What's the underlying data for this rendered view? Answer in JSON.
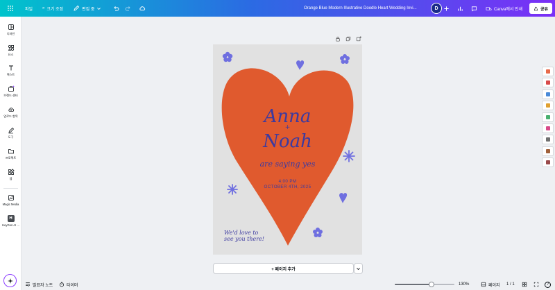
{
  "topbar": {
    "file_label": "파일",
    "resize_label": "크기 조정",
    "editing_label": "편집 중",
    "doc_title": "Orange Blue Modern Illustrative Doodle Heart Wedding Invi...",
    "avatar_initial": "D",
    "print_label": "Canva에서 인쇄",
    "share_label": "공유"
  },
  "sidebar": {
    "items": [
      {
        "label": "디자인",
        "icon": "template-icon"
      },
      {
        "label": "요소",
        "icon": "elements-icon"
      },
      {
        "label": "텍스트",
        "icon": "text-icon"
      },
      {
        "label": "브랜드 센터",
        "icon": "brand-icon"
      },
      {
        "label": "업로드 항목",
        "icon": "upload-icon"
      },
      {
        "label": "도구",
        "icon": "draw-icon"
      },
      {
        "label": "프로젝트",
        "icon": "folder-icon"
      },
      {
        "label": "앱",
        "icon": "apps-icon"
      },
      {
        "label": "Magic Media",
        "icon": "magic-media-icon"
      },
      {
        "label": "HeyGen AI ...",
        "icon": "heygen-icon",
        "glyph": "H"
      }
    ]
  },
  "design": {
    "names_line1": "Anna",
    "plus": "+",
    "names_line2": "Noah",
    "saying": "are saying yes",
    "time": "4:00 PM",
    "date": "OCTOBER 4TH, 2025",
    "note_line1": "We'd love to",
    "note_line2": "see you there!",
    "colors": {
      "background": "#e1e1e1",
      "heart": "#e05a2e",
      "ink": "#3c3aa0",
      "accent": "#6f6fe0"
    }
  },
  "canvas": {
    "add_page_label": "+ 페이지 추가"
  },
  "footer": {
    "notes_label": "발표자 노트",
    "timer_label": "타이머",
    "zoom": "130%",
    "zoom_fraction": 0.62,
    "pages_label": "페이지",
    "page_count": "1 / 1",
    "help": "?"
  },
  "thumbnails": {
    "colors": [
      "#e86a4a",
      "#d84a4a",
      "#4a8ad8",
      "#e0a030",
      "#4ab070",
      "#d84a8a",
      "#707070",
      "#a0603a",
      "#9a4a4a"
    ]
  }
}
